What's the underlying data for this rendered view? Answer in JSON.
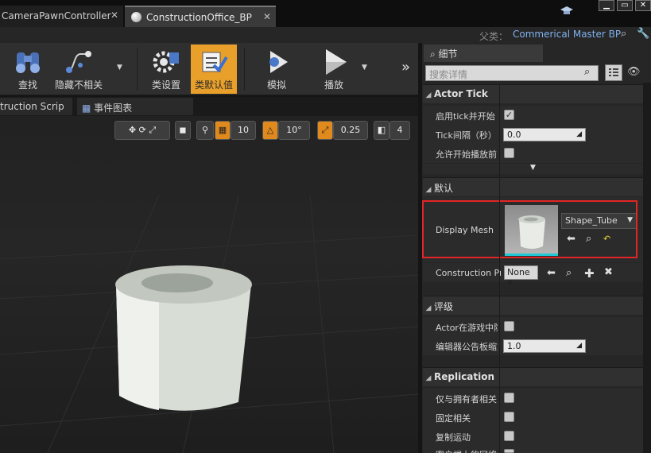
{
  "tabs": [
    {
      "label": "CameraPawnController",
      "close": "✕"
    },
    {
      "label": "ConstructionOffice_BP",
      "close": "✕"
    }
  ],
  "parent": {
    "label": "父类：",
    "value": "Commerical Master BP"
  },
  "toolbar": {
    "buttons": [
      {
        "label": "查找",
        "icon": "binoculars-icon"
      },
      {
        "label": "隐藏不相关",
        "icon": "hide-unrelated-icon"
      },
      {
        "label": "类设置",
        "icon": "class-settings-icon"
      },
      {
        "label": "类默认值",
        "icon": "class-defaults-icon"
      },
      {
        "label": "模拟",
        "icon": "simulate-icon"
      },
      {
        "label": "播放",
        "icon": "play-icon"
      }
    ]
  },
  "graph_tabs": [
    {
      "label": "truction Scrip"
    },
    {
      "label": "事件图表"
    }
  ],
  "viewport": {
    "grid_snap": "10",
    "rotation_snap": "10°",
    "scale_snap": "0.25",
    "camera_speed": "4"
  },
  "details": {
    "tab_label": "细节",
    "search_placeholder": "搜索详情",
    "categories": {
      "actor_tick": "Actor Tick",
      "default": "默认",
      "rendering": "评级",
      "replication": "Replication"
    },
    "actor_tick": {
      "start_with_tick_label": "启用tick并开始",
      "tick_interval_label": "Tick间隔（秒）",
      "tick_interval_value": "0.0",
      "allow_before_begin_label": "允许开始播放前"
    },
    "default": {
      "display_mesh_label": "Display Mesh",
      "display_mesh_value": "Shape_Tube",
      "construction_label": "Construction Pro",
      "construction_value": "None"
    },
    "rendering": {
      "hidden_in_game_label": "Actor在游戏中隐",
      "billboard_scale_label": "编辑器公告板缩放",
      "billboard_scale_value": "1.0"
    },
    "replication": {
      "only_owner_label": "仅与拥有者相关",
      "always_relevant_label": "固定相关",
      "replicate_movement_label": "复制运动",
      "net_load_label": "客户端上的网络加"
    }
  },
  "colors": {
    "accent": "#e9a02b",
    "highlight": "#e32525",
    "link": "#7fb2ee"
  }
}
